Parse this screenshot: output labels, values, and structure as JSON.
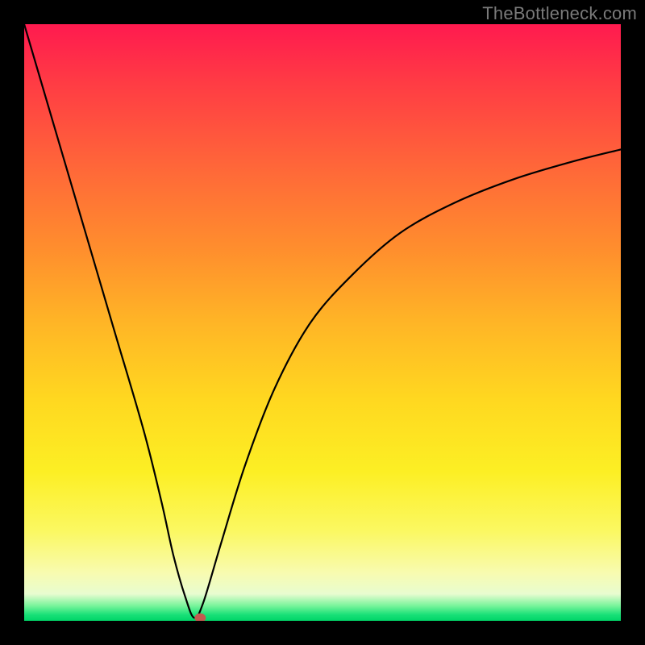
{
  "attribution": "TheBottleneck.com",
  "chart_data": {
    "type": "line",
    "title": "",
    "xlabel": "",
    "ylabel": "",
    "xlim": [
      0,
      100
    ],
    "ylim": [
      0,
      100
    ],
    "series": [
      {
        "name": "bottleneck-curve",
        "x": [
          0,
          5,
          10,
          15,
          20,
          23,
          25,
          27,
          28.5,
          30,
          33,
          37,
          42,
          48,
          55,
          63,
          72,
          82,
          92,
          100
        ],
        "y": [
          100,
          83,
          66,
          49,
          32,
          20,
          11,
          4,
          0.5,
          3,
          13,
          26,
          39,
          50,
          58,
          65,
          70,
          74,
          77,
          79
        ]
      }
    ],
    "marker": {
      "x": 29.5,
      "y": 0.5,
      "label": "optimal-point"
    },
    "background_gradient_stops": [
      {
        "pct": 0,
        "color": "#ff1a4f"
      },
      {
        "pct": 50,
        "color": "#ffb526"
      },
      {
        "pct": 85,
        "color": "#fbf862"
      },
      {
        "pct": 100,
        "color": "#00d568"
      }
    ]
  }
}
